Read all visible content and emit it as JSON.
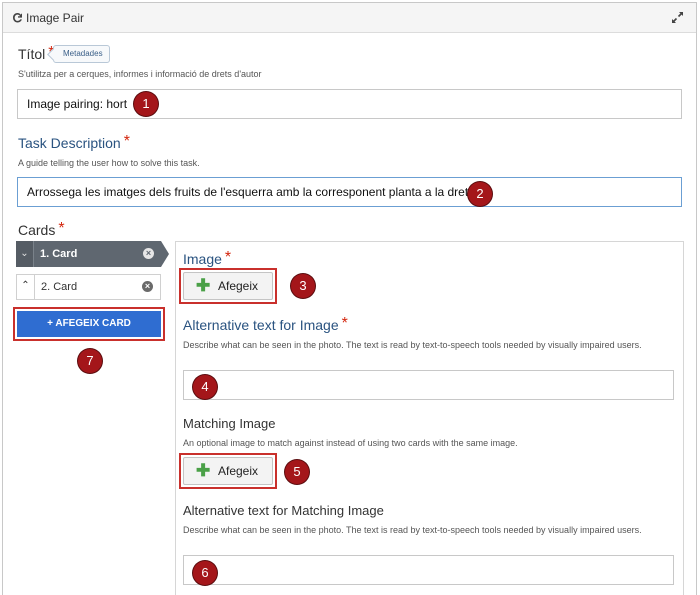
{
  "window": {
    "title": "Image Pair",
    "library_icon": "h5p-icon",
    "expand_icon": "expand-icon"
  },
  "title_field": {
    "label": "Títol",
    "required_mark": "*",
    "metadata_button": "Metadades",
    "description": "S'utilitza per a cerques, informes i informació de drets d'autor",
    "value": "Image pairing: hort"
  },
  "task_description": {
    "label": "Task Description",
    "required_mark": "*",
    "description": "A guide telling the user how to solve this task.",
    "value": "Arrossega les imatges dels fruits de l'esquerra amb la corresponent planta a la dreta"
  },
  "cards": {
    "label": "Cards",
    "required_mark": "*",
    "items": [
      {
        "order_icon": "chevron-down-icon",
        "order_glyph": "⌄",
        "label": "1. Card",
        "remove_glyph": "×",
        "active": true
      },
      {
        "order_icon": "chevron-up-icon",
        "order_glyph": "⌃",
        "label": "2. Card",
        "remove_glyph": "×",
        "active": false
      }
    ],
    "add_button": "+ AFEGEIX CARD"
  },
  "card_panel": {
    "image": {
      "label": "Image",
      "required_mark": "*",
      "button": "Afegeix",
      "plus": "✚"
    },
    "alt_text": {
      "label": "Alternative text for Image",
      "required_mark": "*",
      "description": "Describe what can be seen in the photo. The text is read by text-to-speech tools needed by visually impaired users.",
      "value": ""
    },
    "matching_image": {
      "label": "Matching Image",
      "description": "An optional image to match against instead of using two cards with the same image.",
      "button": "Afegeix",
      "plus": "✚"
    },
    "matching_alt_text": {
      "label": "Alternative text for Matching Image",
      "description": "Describe what can be seen in the photo. The text is read by text-to-speech tools needed by visually impaired users.",
      "value": ""
    }
  },
  "annotations": [
    "1",
    "2",
    "3",
    "4",
    "5",
    "6",
    "7"
  ],
  "colors": {
    "required": "#d3240c",
    "label_blue": "#2a5380",
    "badge": "#a4161a",
    "highlight_border": "#c9302c",
    "add_card_button": "#2f6dd1",
    "active_card": "#5f6770",
    "plus_green": "#4aa047"
  }
}
